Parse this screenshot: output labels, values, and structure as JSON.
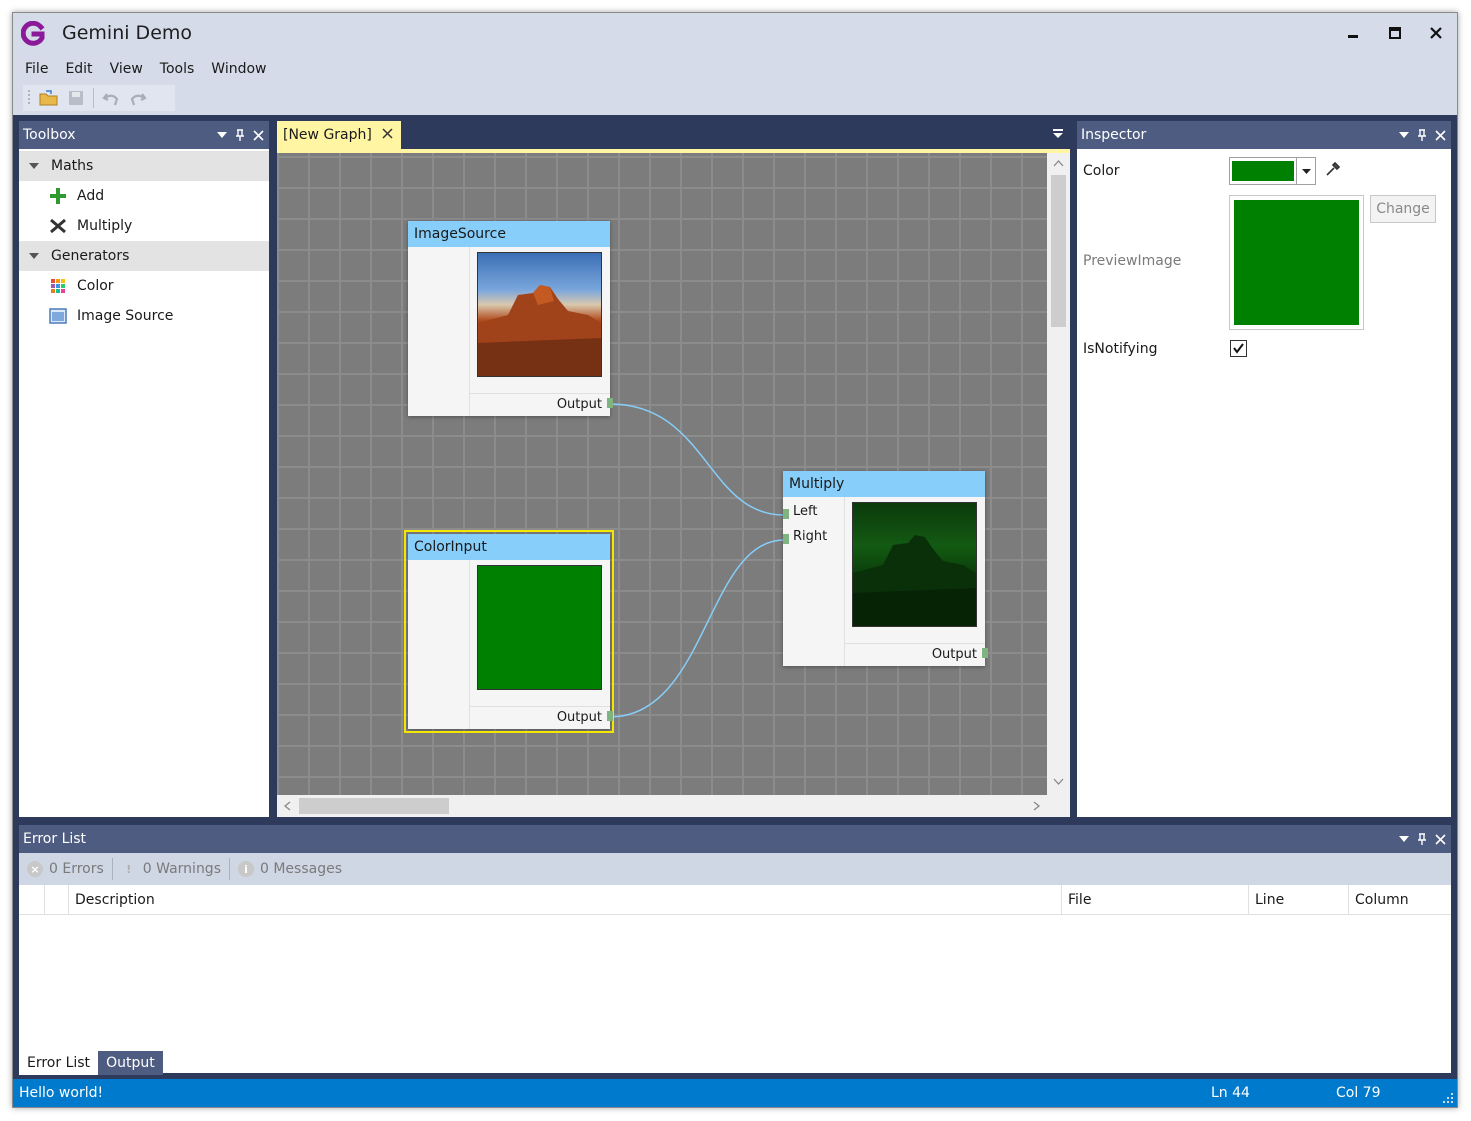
{
  "app": {
    "title": "Gemini Demo",
    "logo_letter": "G"
  },
  "menu": [
    "File",
    "Edit",
    "View",
    "Tools",
    "Window"
  ],
  "toolbox": {
    "title": "Toolbox",
    "groups": [
      {
        "label": "Maths",
        "items": [
          {
            "label": "Add",
            "icon": "plus-icon"
          },
          {
            "label": "Multiply",
            "icon": "multiply-icon"
          }
        ]
      },
      {
        "label": "Generators",
        "items": [
          {
            "label": "Color",
            "icon": "color-grid-icon"
          },
          {
            "label": "Image Source",
            "icon": "image-icon"
          }
        ]
      }
    ]
  },
  "document": {
    "tab_label": "[New Graph]",
    "nodes": {
      "image_source": {
        "title": "ImageSource",
        "output": "Output"
      },
      "color_input": {
        "title": "ColorInput",
        "output": "Output",
        "color": "#008000"
      },
      "multiply": {
        "title": "Multiply",
        "left": "Left",
        "right": "Right",
        "output": "Output"
      }
    }
  },
  "inspector": {
    "title": "Inspector",
    "color_label": "Color",
    "color_value": "#008000",
    "preview_label": "PreviewImage",
    "change_button": "Change",
    "notifying_label": "IsNotifying",
    "notifying_checked": true
  },
  "error_list": {
    "title": "Error List",
    "errors": "0 Errors",
    "warnings": "0 Warnings",
    "messages": "0 Messages",
    "columns": {
      "description": "Description",
      "file": "File",
      "line": "Line",
      "column": "Column"
    }
  },
  "bottom_tabs": {
    "error_list": "Error List",
    "output": "Output"
  },
  "status": {
    "message": "Hello world!",
    "line": "Ln 44",
    "col": "Col 79"
  },
  "colors": {
    "accent": "#007acc",
    "node_header": "#87cefa",
    "selection": "#f3e600",
    "panel_header": "#4d5c80"
  }
}
